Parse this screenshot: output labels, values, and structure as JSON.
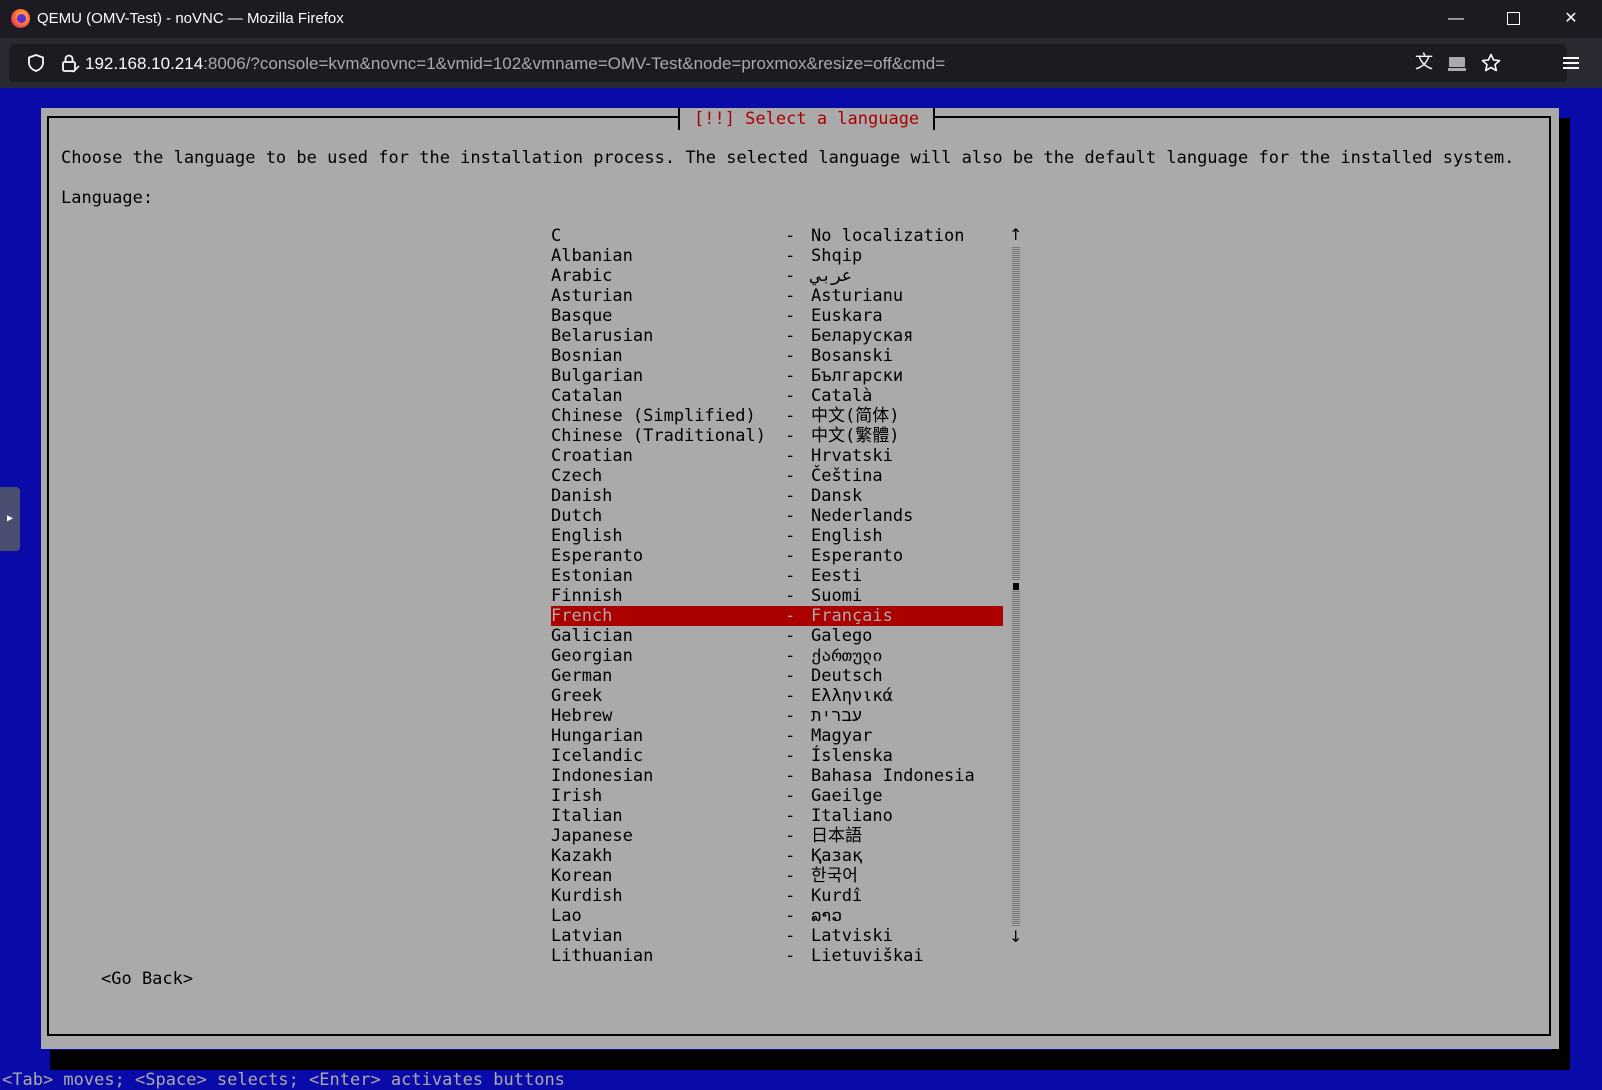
{
  "window": {
    "title": "QEMU (OMV-Test) - noVNC — Mozilla Firefox",
    "minimize_glyph": "—",
    "close_glyph": "✕"
  },
  "urlbar": {
    "host": "192.168.10.214",
    "rest": ":8006/?console=kvm&novnc=1&vmid=102&vmname=OMV-Test&node=proxmox&resize=off&cmd=",
    "icons": [
      "shield-icon",
      "lock-icon",
      "translate-icon",
      "screen-share-icon",
      "bookmark-star-icon",
      "hamburger-menu-icon"
    ]
  },
  "dialog": {
    "title": "[!!] Select a language",
    "intro": "Choose the language to be used for the installation process. The selected language will also be the default language for the installed system.",
    "label": "Language:",
    "go_back": "<Go Back>",
    "selected_index": 19,
    "languages": [
      {
        "name": "C",
        "native": "No localization"
      },
      {
        "name": "Albanian",
        "native": "Shqip"
      },
      {
        "name": "Arabic",
        "native": "عربي"
      },
      {
        "name": "Asturian",
        "native": "Asturianu"
      },
      {
        "name": "Basque",
        "native": "Euskara"
      },
      {
        "name": "Belarusian",
        "native": "Беларуская"
      },
      {
        "name": "Bosnian",
        "native": "Bosanski"
      },
      {
        "name": "Bulgarian",
        "native": "Български"
      },
      {
        "name": "Catalan",
        "native": "Català"
      },
      {
        "name": "Chinese (Simplified)",
        "native": "中文(简体)"
      },
      {
        "name": "Chinese (Traditional)",
        "native": "中文(繁體)"
      },
      {
        "name": "Croatian",
        "native": "Hrvatski"
      },
      {
        "name": "Czech",
        "native": "Čeština"
      },
      {
        "name": "Danish",
        "native": "Dansk"
      },
      {
        "name": "Dutch",
        "native": "Nederlands"
      },
      {
        "name": "English",
        "native": "English"
      },
      {
        "name": "Esperanto",
        "native": "Esperanto"
      },
      {
        "name": "Estonian",
        "native": "Eesti"
      },
      {
        "name": "Finnish",
        "native": "Suomi"
      },
      {
        "name": "French",
        "native": "Français"
      },
      {
        "name": "Galician",
        "native": "Galego"
      },
      {
        "name": "Georgian",
        "native": "ქართული"
      },
      {
        "name": "German",
        "native": "Deutsch"
      },
      {
        "name": "Greek",
        "native": "Ελληνικά"
      },
      {
        "name": "Hebrew",
        "native": "עברית"
      },
      {
        "name": "Hungarian",
        "native": "Magyar"
      },
      {
        "name": "Icelandic",
        "native": "Íslenska"
      },
      {
        "name": "Indonesian",
        "native": "Bahasa Indonesia"
      },
      {
        "name": "Irish",
        "native": "Gaeilge"
      },
      {
        "name": "Italian",
        "native": "Italiano"
      },
      {
        "name": "Japanese",
        "native": "日本語"
      },
      {
        "name": "Kazakh",
        "native": "Қазақ"
      },
      {
        "name": "Korean",
        "native": "한국어"
      },
      {
        "name": "Kurdish",
        "native": "Kurdî"
      },
      {
        "name": "Lao",
        "native": "ລາວ"
      },
      {
        "name": "Latvian",
        "native": "Latviski"
      },
      {
        "name": "Lithuanian",
        "native": "Lietuviškai"
      }
    ],
    "separator": "-"
  },
  "status_line": "<Tab> moves; <Space> selects; <Enter> activates buttons",
  "colors": {
    "vnc_background": "#0a0aa8",
    "dialog_background": "#aaaaaa",
    "selection": "#aa0000",
    "title_text": "#aa0000"
  }
}
